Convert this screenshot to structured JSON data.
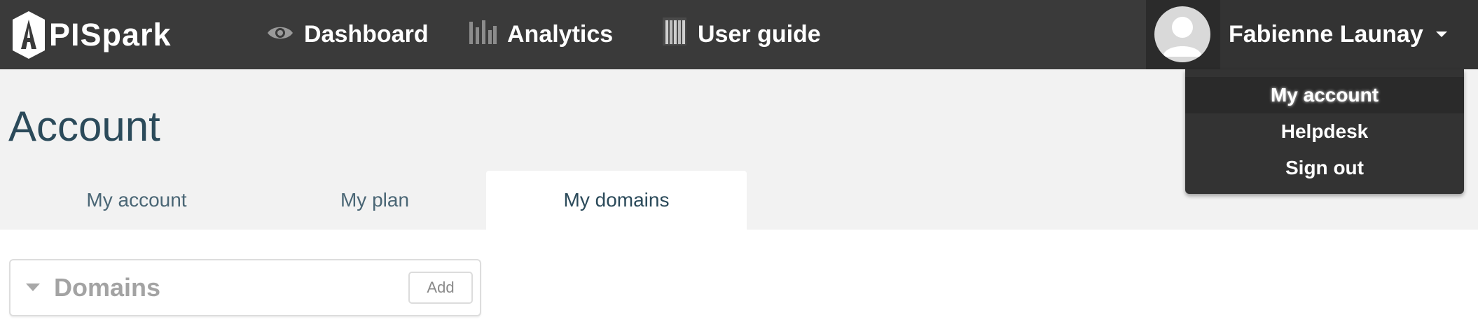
{
  "brand": {
    "name": "PISpark",
    "logo_letter": "A"
  },
  "nav": {
    "dashboard": {
      "label": "Dashboard",
      "icon": "eye-icon"
    },
    "analytics": {
      "label": "Analytics",
      "icon": "bar-chart-icon"
    },
    "user_guide": {
      "label": "User guide",
      "icon": "book-icon"
    }
  },
  "user": {
    "name": "Fabienne Launay",
    "avatar": "avatar-placeholder-icon"
  },
  "dropdown": {
    "items": [
      {
        "label": "My account",
        "active": true
      },
      {
        "label": "Helpdesk",
        "active": false
      },
      {
        "label": "Sign out",
        "active": false
      }
    ]
  },
  "page": {
    "title": "Account",
    "tabs": [
      {
        "label": "My account",
        "active": false
      },
      {
        "label": "My plan",
        "active": false
      },
      {
        "label": "My domains",
        "active": true
      }
    ]
  },
  "domains_panel": {
    "title": "Domains",
    "add_label": "Add",
    "collapsed_icon": "caret-down-icon"
  },
  "colors": {
    "navbar": "#3a3a3a",
    "header_band": "#f2f2f2",
    "title": "#2b4a5a",
    "tab_text": "#4a6675"
  }
}
